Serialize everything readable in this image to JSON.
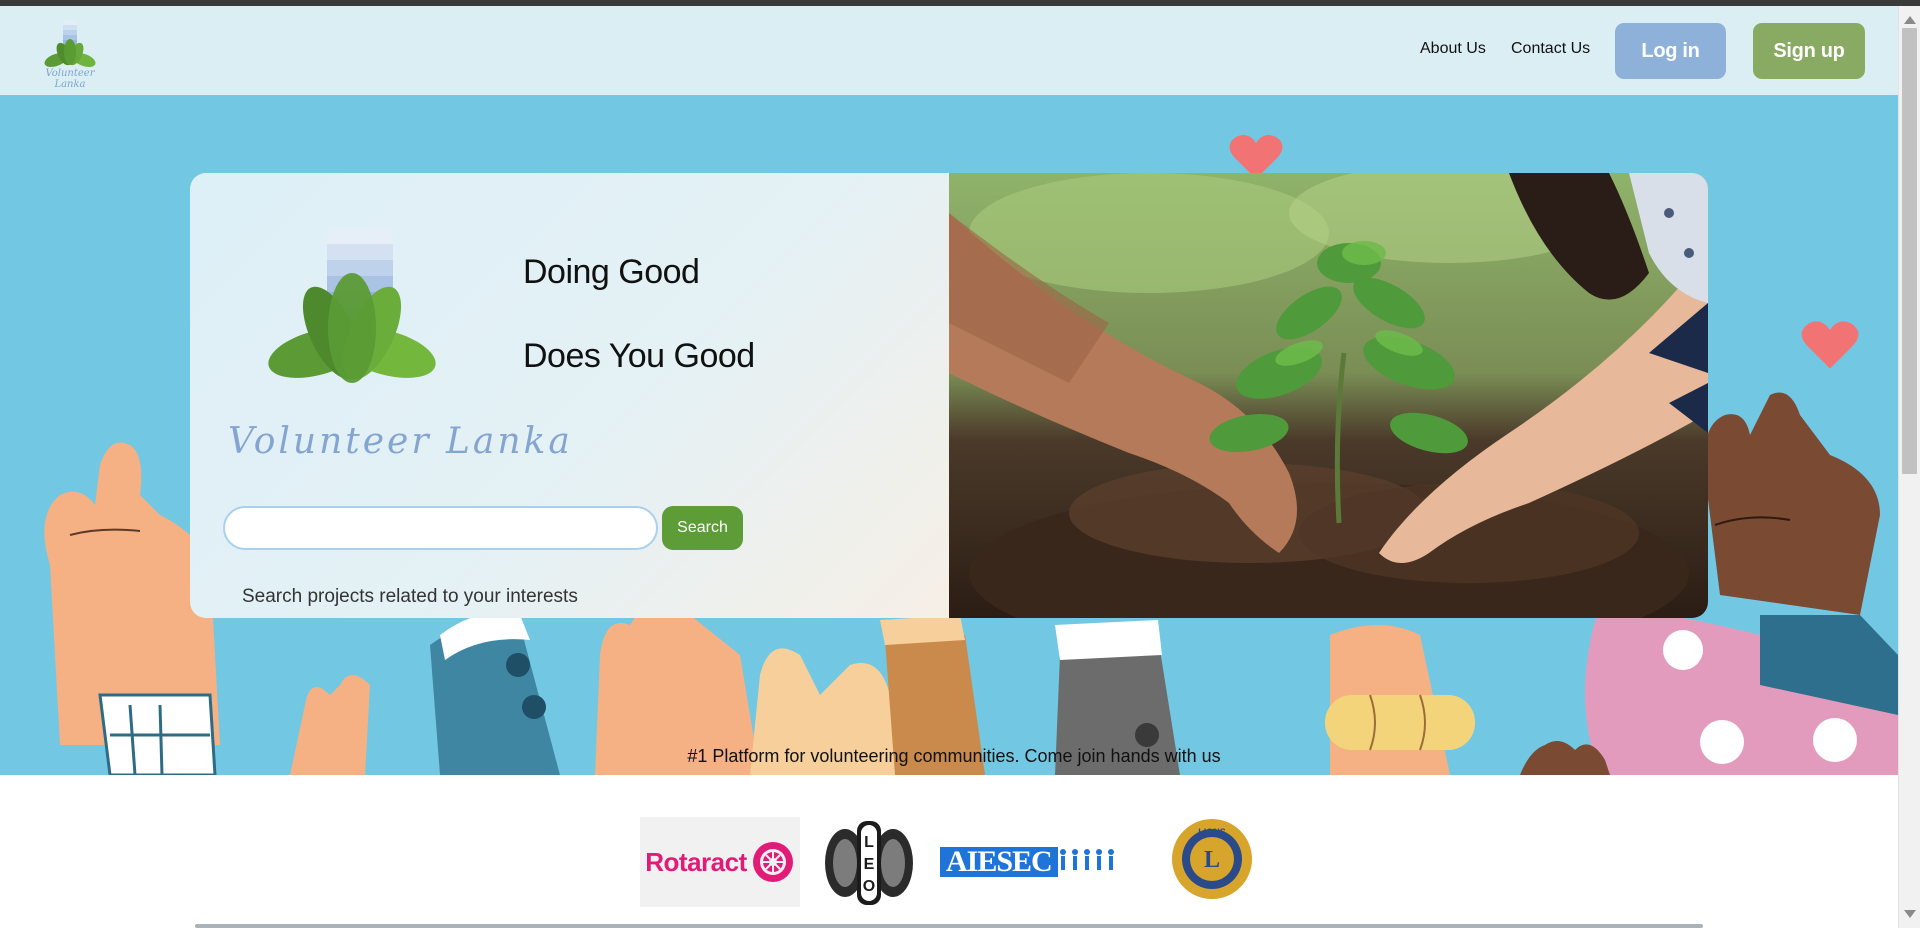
{
  "header": {
    "brand_name": "Volunteer Lanka",
    "nav": {
      "about": "About Us",
      "contact": "Contact Us"
    },
    "login_label": "Log in",
    "signup_label": "Sign up"
  },
  "hero": {
    "brand_name": "Volunteer Lanka",
    "tagline_line1": "Doing Good",
    "tagline_line2": "Does You Good",
    "search": {
      "value": "",
      "placeholder": "",
      "button_label": "Search"
    },
    "search_hint": "Search projects related to your interests",
    "platform_text": "#1 Platform for volunteering communities. Come join hands with us"
  },
  "partners": {
    "rotaract_label": "Rotaract",
    "leo_label": "LEO",
    "aiesec_label": "AIESEC",
    "lions_label": "LIONS"
  },
  "colors": {
    "header_bg": "#dbeef4",
    "hero_bg": "#72c8e3",
    "login_btn": "#8eb1d9",
    "signup_btn": "#88aa62",
    "search_btn": "#5e9c38",
    "brand_text": "#85a5d1",
    "heart": "#f27373"
  },
  "icons": [
    "lotus-logo-icon",
    "heart-icon",
    "search-icon"
  ]
}
